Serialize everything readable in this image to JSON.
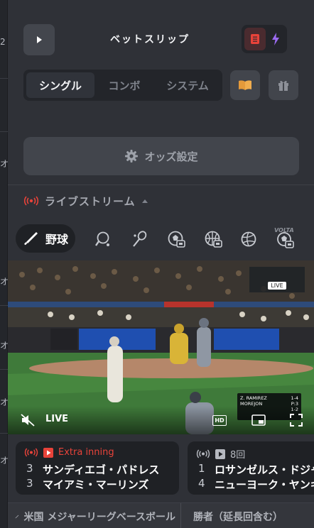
{
  "edge": {
    "chars": [
      "2",
      "オ",
      "オ",
      "オ",
      "オ",
      "オ"
    ]
  },
  "header": {
    "title": "ベットスリップ",
    "play_icon": "play-icon",
    "slip_icon": "receipt-icon",
    "quick_icon": "lightning-icon"
  },
  "bet_types": {
    "tabs": [
      "シングル",
      "コンボ",
      "システム"
    ],
    "active": "シングル",
    "book_icon": "book-icon",
    "gift_icon": "gift-icon"
  },
  "odds_settings": {
    "label": "オッズ設定",
    "icon": "gear-icon"
  },
  "live_stream": {
    "label": "ライブストリーム",
    "icon": "broadcast-icon",
    "collapse_icon": "chevron-up-icon"
  },
  "sports": {
    "active_label": "野球",
    "active_icon": "baseball-bat-icon",
    "icons": [
      "table-tennis-icon",
      "badminton-icon",
      "esports-soccer-icon",
      "esports-basketball-icon",
      "volleyball-icon",
      "volta-soccer-icon"
    ],
    "volta_label": "VOLTA"
  },
  "video": {
    "live_label": "LIVE",
    "hd_label": "HD",
    "pip_live": "LIVE",
    "scorebug": {
      "line1_name": "Z. RAMIREZ",
      "line1_val": "1-4",
      "line2_name": "MOREJON",
      "line2_val": "P:3",
      "count": "1-2"
    },
    "mute_icon": "mute-icon",
    "pip_icon": "picture-in-picture-icon",
    "fullscreen_icon": "fullscreen-icon"
  },
  "matches": [
    {
      "status": "Extra inning",
      "status_color": "#e8433a",
      "teams": [
        {
          "score": "3",
          "name": "サンディエゴ・パドレス"
        },
        {
          "score": "3",
          "name": "マイアミ・マーリンズ"
        }
      ]
    },
    {
      "status": "8回",
      "status_color": "#b6b9c0",
      "teams": [
        {
          "score": "1",
          "name": "ロサンゼルス・ドジャース"
        },
        {
          "score": "4",
          "name": "ニューヨーク・ヤンキース"
        }
      ]
    }
  ],
  "footer": {
    "league": "米国 メジャーリーグベースボール",
    "league_icon": "baseball-bat-icon",
    "market": "勝者（延長回含む）"
  },
  "colors": {
    "accent_red": "#e8433a",
    "accent_purple": "#9b6bf2",
    "accent_orange": "#e59a3a",
    "panel_bg": "#2f3137"
  }
}
